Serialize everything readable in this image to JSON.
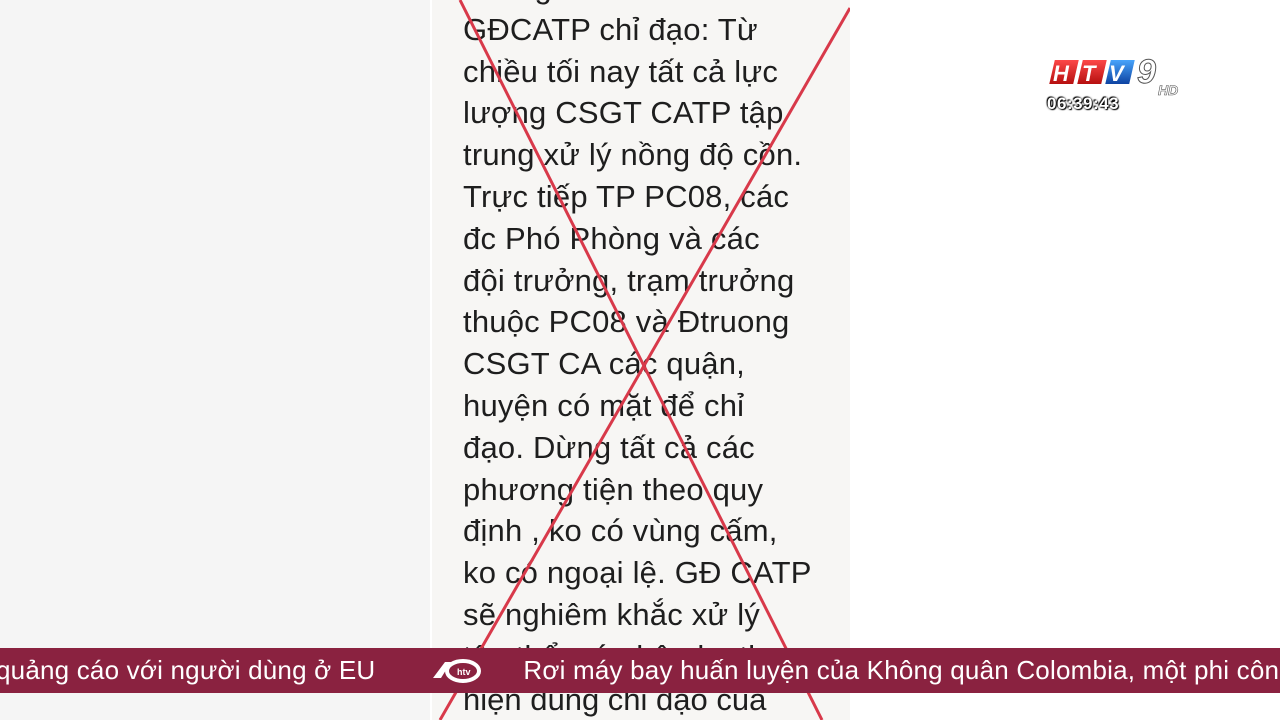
{
  "broadcast": {
    "channel_logo_text": "HTV9",
    "hd_badge": "HD",
    "clock": "06:39:43"
  },
  "document": {
    "lines": [
      "Thông báo:",
      "GĐCATP chỉ đạo: Từ",
      "chiều tối nay tất cả lực",
      "lượng CSGT CATP tập",
      "trung xử lý nồng độ cồn.",
      "Trực tiếp TP PC08, các",
      "đc Phó Phòng và các",
      "đội trưởng, trạm trưởng",
      "thuộc PC08 và Đtruong",
      "CSGT CA các quận,",
      "huyện có mặt để chỉ",
      "đạo. Dừng tất cả các",
      "phương tiện theo quy",
      "định , ko có vùng cấm,",
      "ko có ngoại lệ. GĐ CATP",
      "sẽ nghiêm khắc xử lý",
      "tập thể, cá nhân ko thực"
    ],
    "last_line": "hiện đúng chỉ đạo của",
    "cross_color": "#d8394a"
  },
  "ticker": {
    "items": [
      "quảng cáo với người dùng ở EU",
      "Rơi máy bay huấn luyện của Không quân Colombia, một phi công thiệt mạng"
    ],
    "separator_icon": "htv-ticker-logo-icon",
    "background": "#8a2240"
  }
}
